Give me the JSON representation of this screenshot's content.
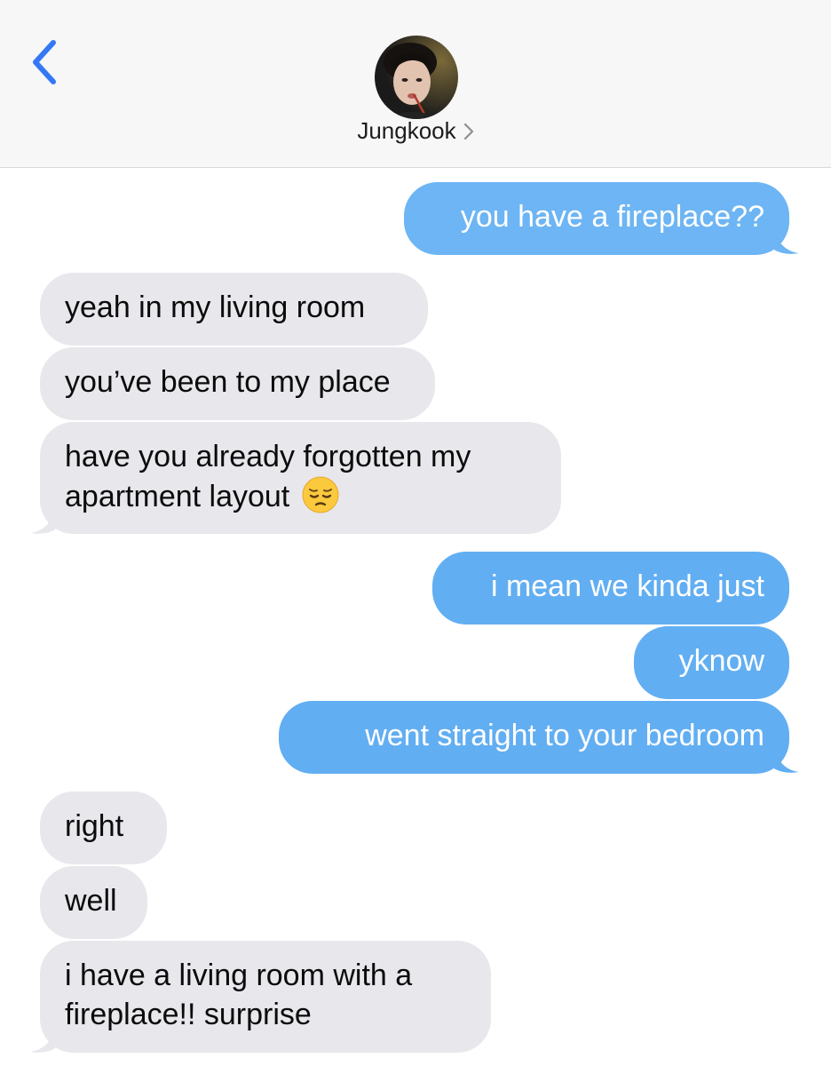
{
  "header": {
    "back_icon": "chevron-left-icon",
    "contact_name": "Jungkook",
    "contact_chevron": "›",
    "accent": "#3478f6"
  },
  "colors": {
    "outgoing_bubble": "#62aef2",
    "incoming_bubble": "#e7e7ec"
  },
  "messages": [
    {
      "from": "me",
      "text": "you have a fireplace??"
    },
    {
      "from": "them",
      "text": "yeah in my living room"
    },
    {
      "from": "them",
      "text": "you’ve been to my place"
    },
    {
      "from": "them",
      "text": "have you already forgotten my apartment layout",
      "emoji": "pensive-face"
    },
    {
      "from": "me",
      "text": "i mean we kinda just"
    },
    {
      "from": "me",
      "text": "yknow"
    },
    {
      "from": "me",
      "text": "went straight to your bedroom"
    },
    {
      "from": "them",
      "text": "right"
    },
    {
      "from": "them",
      "text": "well"
    },
    {
      "from": "them",
      "text": "i have a living room with a fireplace!! surprise"
    }
  ]
}
